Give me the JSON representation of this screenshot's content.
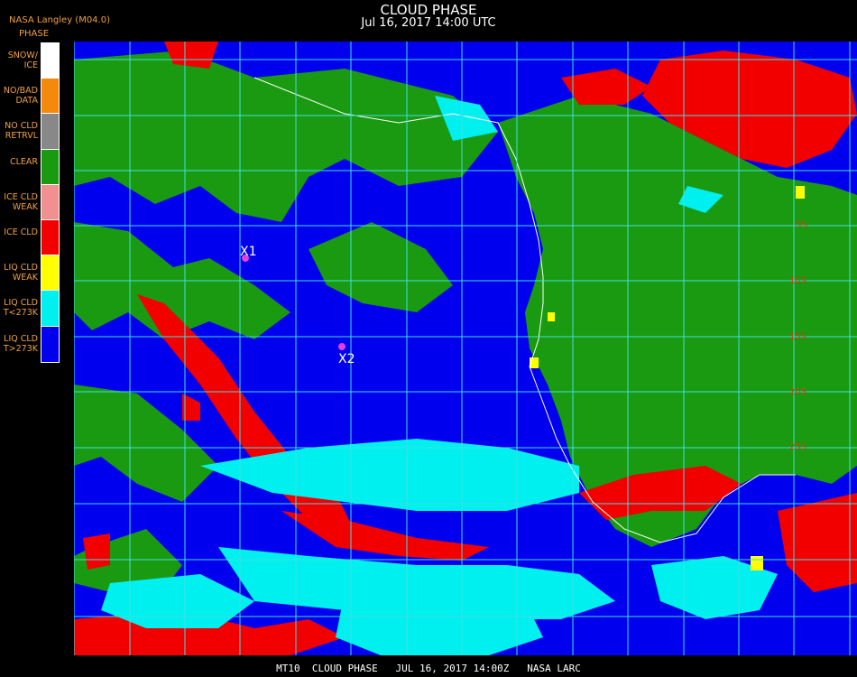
{
  "title": "CLOUD PHASE",
  "subtitle": "Jul 16, 2017 14:00 UTC",
  "provider": "NASA Langley (M04.0)",
  "legend_heading": "PHASE",
  "legend": [
    {
      "label": "SNOW/\nICE",
      "color": "#ffffff"
    },
    {
      "label": "NO/BAD\nDATA",
      "color": "#f58a0a"
    },
    {
      "label": "NO CLD\nRETRVL",
      "color": "#888888"
    },
    {
      "label": "CLEAR",
      "color": "#1a9a10"
    },
    {
      "label": "ICE CLD\nWEAK",
      "color": "#f09090"
    },
    {
      "label": "ICE CLD",
      "color": "#f20000"
    },
    {
      "label": "LIQ CLD\nWEAK",
      "color": "#ffff00"
    },
    {
      "label": "LIQ CLD\nT<273K",
      "color": "#00f0f0"
    },
    {
      "label": "LIQ CLD\nT>273K",
      "color": "#0000ee"
    }
  ],
  "markers": [
    {
      "label": "X1"
    },
    {
      "label": "X2"
    }
  ],
  "lat_labels": [
    "5S",
    "10S",
    "15S",
    "20S",
    "25S"
  ],
  "footer": "MT10  CLOUD PHASE   JUL 16, 2017 14:00Z   NASA LARC"
}
